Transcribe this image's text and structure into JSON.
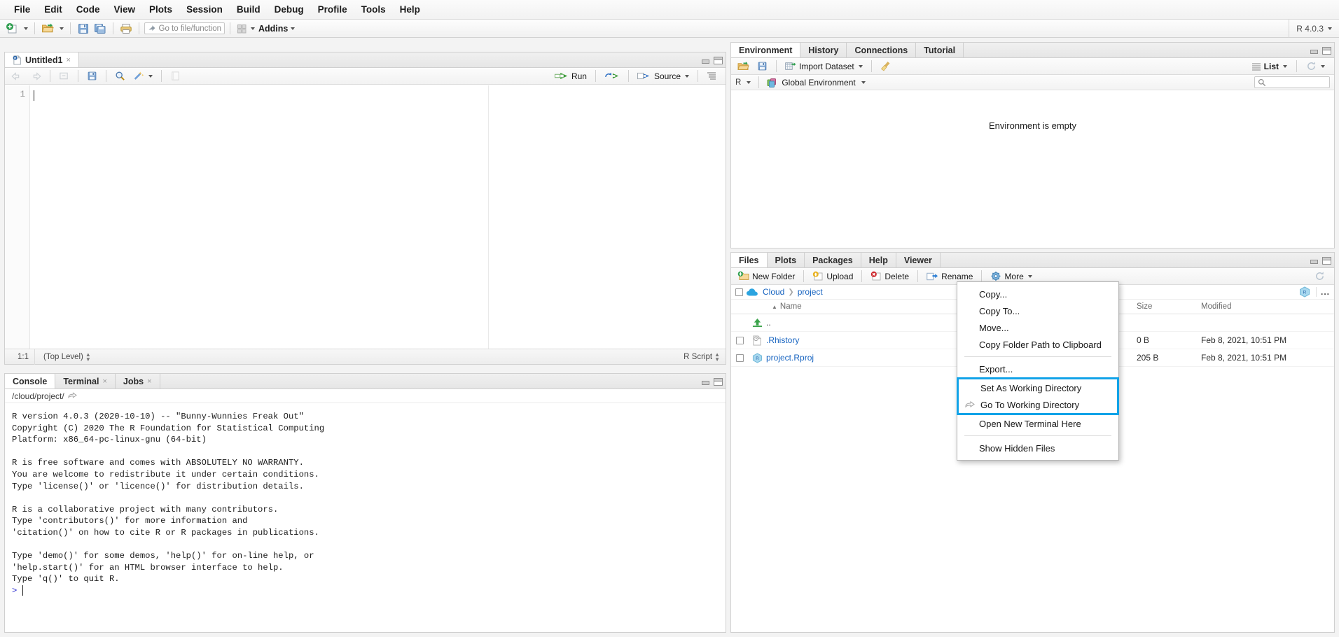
{
  "menubar": {
    "items": [
      "File",
      "Edit",
      "Code",
      "View",
      "Plots",
      "Session",
      "Build",
      "Debug",
      "Profile",
      "Tools",
      "Help"
    ]
  },
  "toolbar": {
    "goto_placeholder": "Go to file/function",
    "addins_label": "Addins",
    "r_version": "R 4.0.3"
  },
  "source": {
    "tab_label": "Untitled1",
    "tab_close": "×",
    "run_label": "Run",
    "source_label": "Source",
    "line_number": "1",
    "status": {
      "position": "1:1",
      "scope": "(Top Level)",
      "filetype": "R Script"
    }
  },
  "console": {
    "tabs": [
      {
        "label": "Console",
        "closable": false
      },
      {
        "label": "Terminal",
        "closable": true
      },
      {
        "label": "Jobs",
        "closable": true
      }
    ],
    "path": "/cloud/project/",
    "output": "R version 4.0.3 (2020-10-10) -- \"Bunny-Wunnies Freak Out\"\nCopyright (C) 2020 The R Foundation for Statistical Computing\nPlatform: x86_64-pc-linux-gnu (64-bit)\n\nR is free software and comes with ABSOLUTELY NO WARRANTY.\nYou are welcome to redistribute it under certain conditions.\nType 'license()' or 'licence()' for distribution details.\n\nR is a collaborative project with many contributors.\nType 'contributors()' for more information and\n'citation()' on how to cite R or R packages in publications.\n\nType 'demo()' for some demos, 'help()' for on-line help, or\n'help.start()' for an HTML browser interface to help.\nType 'q()' to quit R.\n",
    "prompt": ">"
  },
  "environment": {
    "tabs": [
      "Environment",
      "History",
      "Connections",
      "Tutorial"
    ],
    "import_label": "Import Dataset",
    "view_mode": "List",
    "language": "R",
    "scope": "Global Environment",
    "empty_message": "Environment is empty",
    "search_placeholder": ""
  },
  "files": {
    "tabs": [
      "Files",
      "Plots",
      "Packages",
      "Help",
      "Viewer"
    ],
    "toolbar": {
      "new_folder": "New Folder",
      "upload": "Upload",
      "delete": "Delete",
      "rename": "Rename",
      "more": "More"
    },
    "breadcrumb": [
      "Cloud",
      "project"
    ],
    "columns": {
      "name": "Name",
      "size": "Size",
      "modified": "Modified"
    },
    "rows": [
      {
        "name": "..",
        "size": "",
        "modified": "",
        "icon": "up-folder-icon",
        "checkbox": false,
        "link": false
      },
      {
        "name": ".Rhistory",
        "size": "0 B",
        "modified": "Feb 8, 2021, 10:51 PM",
        "icon": "history-file-icon",
        "checkbox": true,
        "link": true
      },
      {
        "name": "project.Rproj",
        "size": "205 B",
        "modified": "Feb 8, 2021, 10:51 PM",
        "icon": "rproj-file-icon",
        "checkbox": true,
        "link": true
      }
    ],
    "more_dots": "..."
  },
  "context_menu": {
    "items": [
      {
        "label": "Copy...",
        "icon": null,
        "group": 1
      },
      {
        "label": "Copy To...",
        "icon": null,
        "group": 1
      },
      {
        "label": "Move...",
        "icon": null,
        "group": 1
      },
      {
        "label": "Copy Folder Path to Clipboard",
        "icon": null,
        "group": 1
      },
      {
        "label": "Export...",
        "icon": null,
        "group": 2
      },
      {
        "label": "Set As Working Directory",
        "icon": null,
        "group": 3,
        "highlighted": true
      },
      {
        "label": "Go To Working Directory",
        "icon": "arrow-right-icon",
        "group": 3,
        "highlighted": true
      },
      {
        "label": "Open New Terminal Here",
        "icon": null,
        "group": 4
      },
      {
        "label": "Show Hidden Files",
        "icon": null,
        "group": 5
      }
    ],
    "highlight_color": "#11a3e8"
  },
  "colors": {
    "link": "#1764c0",
    "accent": "#11a3e8",
    "prompt": "#2a2ad0"
  }
}
